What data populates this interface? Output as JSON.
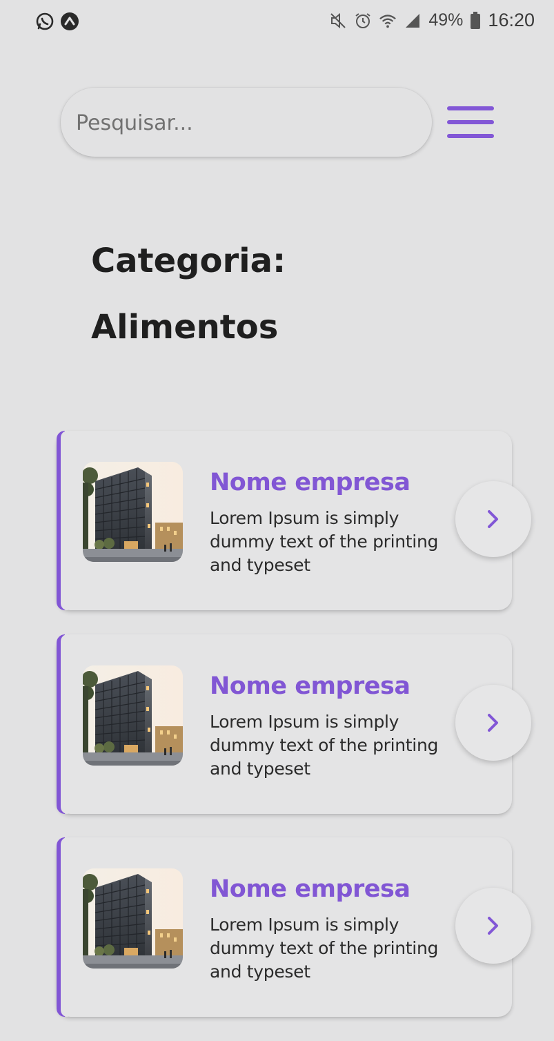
{
  "status_bar": {
    "left_icons": [
      "whatsapp-icon",
      "app-notification-icon"
    ],
    "right_icons": [
      "mute-icon",
      "alarm-icon",
      "wifi-icon",
      "signal-icon",
      "battery-icon"
    ],
    "battery": "49%",
    "time": "16:20"
  },
  "search": {
    "placeholder": "Pesquisar...",
    "value": ""
  },
  "menu": {
    "icon": "hamburger-menu-icon"
  },
  "page": {
    "title_line1": "Categoria:",
    "title_line2": "Alimentos"
  },
  "cards": [
    {
      "title": "Nome empresa",
      "description": "Lorem Ipsum is simply dummy text of the printing and typeset",
      "image": "building-thumbnail",
      "action_icon": "chevron-right-icon"
    },
    {
      "title": "Nome empresa",
      "description": "Lorem Ipsum is simply dummy text of the printing and typeset",
      "image": "building-thumbnail",
      "action_icon": "chevron-right-icon"
    },
    {
      "title": "Nome empresa",
      "description": "Lorem Ipsum is simply dummy text of the printing and typeset",
      "image": "building-thumbnail",
      "action_icon": "chevron-right-icon"
    }
  ],
  "colors": {
    "accent": "#8257d6",
    "background": "#e2e2e3",
    "text": "#1f1f1f"
  }
}
